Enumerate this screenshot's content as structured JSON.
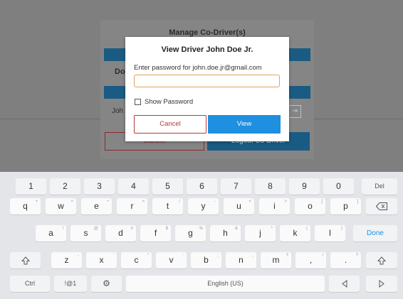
{
  "background_dialog": {
    "title": "Manage Co-Driver(s)",
    "row1_label": "Do",
    "row2_label": "Joh",
    "cancel_label": "Cancel",
    "logout_label": "Logout Co-Driver",
    "icon_name": "edit-icon"
  },
  "modal": {
    "title": "View Driver John Doe Jr.",
    "prompt": "Enter password for john.doe.jr@gmail.com",
    "password_value": "",
    "password_placeholder": "",
    "show_password_label": "Show Password",
    "show_password_checked": false,
    "cancel_label": "Cancel",
    "view_label": "View"
  },
  "keyboard": {
    "number_row": [
      "1",
      "2",
      "3",
      "4",
      "5",
      "6",
      "7",
      "8",
      "9",
      "0"
    ],
    "del_label": "Del",
    "row1": [
      {
        "k": "q",
        "s": "+"
      },
      {
        "k": "w",
        "s": "×"
      },
      {
        "k": "e",
        "s": "÷"
      },
      {
        "k": "r",
        "s": "="
      },
      {
        "k": "t",
        "s": "/"
      },
      {
        "k": "y",
        "s": "-"
      },
      {
        "k": "u",
        "s": "<"
      },
      {
        "k": "i",
        "s": ">"
      },
      {
        "k": "o",
        "s": "["
      },
      {
        "k": "p",
        "s": "]"
      }
    ],
    "backspace_icon": "backspace-icon",
    "row2": [
      {
        "k": "a",
        "s": "!"
      },
      {
        "k": "s",
        "s": "@"
      },
      {
        "k": "d",
        "s": "#"
      },
      {
        "k": "f",
        "s": "$"
      },
      {
        "k": "g",
        "s": "%"
      },
      {
        "k": "h",
        "s": "&"
      },
      {
        "k": "j",
        "s": "*"
      },
      {
        "k": "k",
        "s": "("
      },
      {
        "k": "l",
        "s": ")"
      }
    ],
    "done_label": "Done",
    "shift_icon": "shift-icon",
    "row3": [
      {
        "k": "z",
        "s": "-"
      },
      {
        "k": "x",
        "s": "'"
      },
      {
        "k": "c",
        "s": "\""
      },
      {
        "k": "v",
        "s": ":"
      },
      {
        "k": "b",
        "s": ";"
      },
      {
        "k": "n",
        "s": ","
      },
      {
        "k": "m",
        "s": "?"
      }
    ],
    "comma": ",",
    "comma_sup": "!",
    "period": ".",
    "period_sup": "?",
    "ctrl_label": "Ctrl",
    "symbols_label": "!@1",
    "settings_icon": "gear-icon",
    "space_label": "English (US)",
    "left_arrow_icon": "left-arrow-icon",
    "right_arrow_icon": "right-arrow-icon"
  },
  "colors": {
    "accent_blue": "#1f8fe0",
    "cancel_red": "#b63a3a",
    "input_border": "#e0a35a"
  }
}
